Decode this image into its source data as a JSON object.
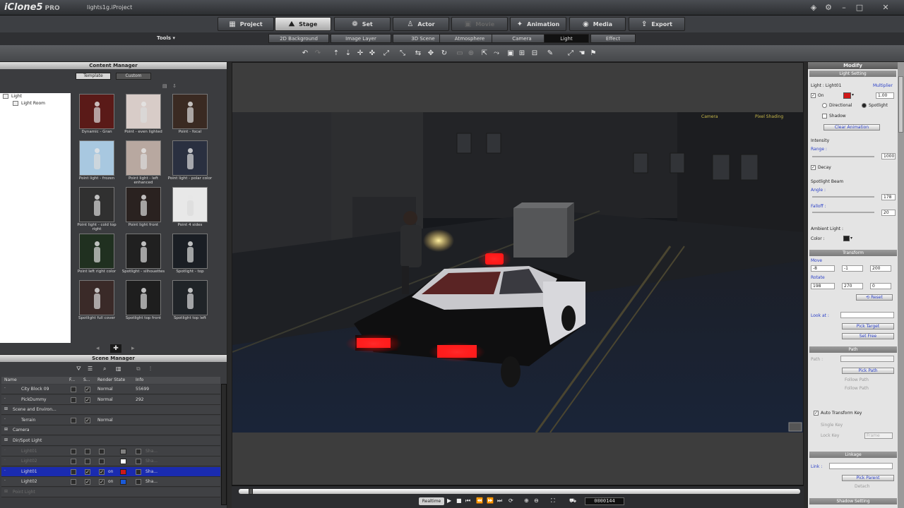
{
  "app": {
    "logo": "iClone5",
    "edition": "PRO",
    "project": "lights1g.iProject",
    "window_controls": [
      "help-icon",
      "settings-icon",
      "minimize-icon",
      "maximize-icon",
      "close-icon"
    ]
  },
  "main_tabs": [
    {
      "label": "Project",
      "icon": "project-icon",
      "state": "normal"
    },
    {
      "label": "Stage",
      "icon": "stage-icon",
      "state": "active"
    },
    {
      "label": "Set",
      "icon": "set-icon",
      "state": "normal"
    },
    {
      "label": "Actor",
      "icon": "actor-icon",
      "state": "normal"
    },
    {
      "label": "Movie",
      "icon": "movie-icon",
      "state": "disabled"
    },
    {
      "label": "Animation",
      "icon": "animation-icon",
      "state": "normal"
    },
    {
      "label": "Media",
      "icon": "media-icon",
      "state": "normal"
    },
    {
      "label": "Export",
      "icon": "export-icon",
      "state": "normal"
    }
  ],
  "tools_label": "Tools ▾",
  "sub_tabs": [
    {
      "label": "2D Background",
      "active": false
    },
    {
      "label": "Image Layer",
      "active": false
    },
    {
      "label": "3D Scene",
      "active": false
    },
    {
      "label": "Atmosphere",
      "active": false
    },
    {
      "label": "Camera",
      "active": false
    },
    {
      "label": "Light",
      "active": true
    },
    {
      "label": "Effect",
      "active": false
    }
  ],
  "content_manager": {
    "title": "Content Manager",
    "tabs": [
      {
        "label": "Template",
        "active": true
      },
      {
        "label": "Custom",
        "active": false
      }
    ],
    "tree": [
      {
        "label": "Light",
        "level": 0
      },
      {
        "label": "Light Room",
        "level": 1
      }
    ],
    "thumbnails": [
      {
        "label": "Dynamic - Gran",
        "bg": "#5a1a18"
      },
      {
        "label": "Point - even lighted",
        "bg": "#d8ccc8"
      },
      {
        "label": "Point - focal",
        "bg": "#3a2a22"
      },
      {
        "label": "Point light - frozen",
        "bg": "#a8c8e0"
      },
      {
        "label": "Point light - left enhanced",
        "bg": "#b8a8a0"
      },
      {
        "label": "Point light - polar color",
        "bg": "#2a3040"
      },
      {
        "label": "Point light - cold top right",
        "bg": "#303030"
      },
      {
        "label": "Point light front",
        "bg": "#2a2220"
      },
      {
        "label": "Point 4 sides",
        "bg": "#e8e8e8"
      },
      {
        "label": "Point left right color",
        "bg": "#203020"
      },
      {
        "label": "Spotlight - silhouettes",
        "bg": "#202020"
      },
      {
        "label": "Spotlight - top",
        "bg": "#1a1e24"
      },
      {
        "label": "Spotlight full cover",
        "bg": "#3a2a28"
      },
      {
        "label": "Spotlight top front",
        "bg": "#1e1e1e"
      },
      {
        "label": "Spotlight top left",
        "bg": "#202428"
      }
    ]
  },
  "scene_manager": {
    "title": "Scene Manager",
    "columns": [
      "Name",
      "F...",
      "S...",
      "Render State",
      "Info"
    ],
    "rows": [
      {
        "name": "City Block 09",
        "v": true,
        "state": "Normal",
        "info": "55699",
        "sel": false,
        "dim": false,
        "type": "obj"
      },
      {
        "name": "PickDummy",
        "v": true,
        "state": "Normal",
        "info": "292",
        "sel": false,
        "dim": false,
        "type": "obj"
      },
      {
        "name": "Scene and Environ...",
        "v": false,
        "state": "",
        "info": "",
        "sel": false,
        "dim": false,
        "type": "group"
      },
      {
        "name": "Terrain",
        "v": true,
        "state": "Normal",
        "info": "",
        "sel": false,
        "dim": false,
        "type": "obj"
      },
      {
        "name": "Camera",
        "v": false,
        "state": "",
        "info": "",
        "sel": false,
        "dim": false,
        "type": "group"
      },
      {
        "name": "Dir/Spot Light",
        "v": false,
        "state": "",
        "info": "",
        "sel": false,
        "dim": false,
        "type": "group"
      },
      {
        "name": "Light01",
        "v": false,
        "state": "",
        "info": "Sha...",
        "sel": false,
        "dim": true,
        "type": "light",
        "color": "#808080"
      },
      {
        "name": "Light02",
        "v": false,
        "state": "",
        "info": "Sha...",
        "sel": false,
        "dim": true,
        "type": "light",
        "color": "#ffffff"
      },
      {
        "name": "Light01",
        "v": true,
        "state": "on",
        "info": "Sha...",
        "sel": true,
        "dim": false,
        "type": "light",
        "color": "#d01818"
      },
      {
        "name": "Light02",
        "v": true,
        "state": "on",
        "info": "Sha...",
        "sel": false,
        "dim": false,
        "type": "light",
        "color": "#1a5ad8"
      },
      {
        "name": "Point Light",
        "v": false,
        "state": "",
        "info": "",
        "sel": false,
        "dim": true,
        "type": "group"
      }
    ]
  },
  "viewport": {
    "camera_label": "Camera",
    "shading_label": "Pixel Shading"
  },
  "timeline": {
    "realtime_label": "Realtime",
    "frame": "0000144"
  },
  "modify": {
    "title": "Modify",
    "light_setting": "Light Setting",
    "light_name_label": "Light : Light01",
    "multiplier_label": "Multiplier",
    "on_label": "On",
    "multiplier_value": "1.00",
    "directional_label": "Directional",
    "spotlight_label": "Spotlight",
    "shadow_label": "Shadow",
    "clear_animation": "Clear Animation",
    "intensity_label": "Intensity",
    "range_label": "Range :",
    "range_value": "1000",
    "decay_label": "Decay",
    "spot_beam_label": "Spotlight Beam",
    "angle_label": "Angle :",
    "angle_value": "178",
    "falloff_label": "Falloff :",
    "falloff_value": "20",
    "ambient_label": "Ambient Light :",
    "color_label": "Color :",
    "light_color": "#d01818",
    "ambient_color": "#222222",
    "transform_label": "Transform",
    "move_label": "Move",
    "move_values": [
      "-8",
      "-1",
      "200"
    ],
    "rotate_label": "Rotate",
    "rotate_values": [
      "198",
      "270",
      "0"
    ],
    "reset_label": "Reset",
    "look_at_label": "Look at :",
    "pick_target_label": "Pick Target",
    "set_free_label": "Set Free",
    "path_label": "Path",
    "path_field_label": "Path :",
    "pick_path_label": "Pick Path",
    "path_opt1": "Follow Path",
    "path_opt2": "Follow Path",
    "auto_transform_label": "Auto Transform Key",
    "sub1": "Single Key",
    "sub2": "Lock Key",
    "sub3": "Frame",
    "linkage_label": "Linkage",
    "link_label": "Link :",
    "pick_parent_label": "Pick Parent",
    "detach_label": "Detach",
    "shadow_setting_label": "Shadow Setting"
  }
}
